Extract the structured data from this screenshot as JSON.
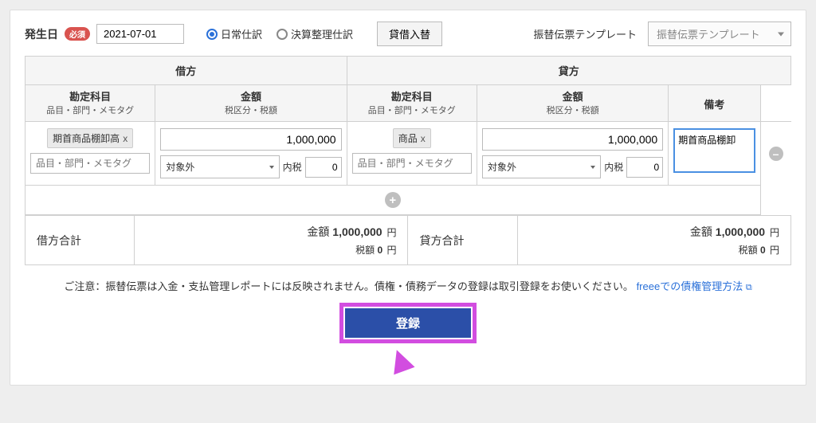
{
  "top": {
    "dateLabel": "発生日",
    "requiredBadge": "必須",
    "dateValue": "2021-07-01",
    "radio1": "日常仕訳",
    "radio2": "決算整理仕訳",
    "swapBtn": "貸借入替",
    "templateLabel": "振替伝票テンプレート",
    "templatePlaceholder": "振替伝票テンプレート"
  },
  "headers": {
    "debit": "借方",
    "credit": "貸方",
    "account": "勘定科目",
    "accountSub": "品目・部門・メモタグ",
    "amount": "金額",
    "amountSub": "税区分・税額",
    "remarks": "備考"
  },
  "row": {
    "debitAccount": "期首商品棚卸高",
    "debitAmount": "1,000,000",
    "creditAccount": "商品",
    "creditAmount": "1,000,000",
    "tagPlaceholder": "品目・部門・メモタグ",
    "taxClass": "対象外",
    "taxIncLabel": "内税",
    "taxAmt": "0",
    "memo": "期首商品棚卸"
  },
  "totals": {
    "debitLabel": "借方合計",
    "creditLabel": "貸方合計",
    "amountLabel": "金額",
    "debitAmount": "1,000,000",
    "creditAmount": "1,000,000",
    "yen": "円",
    "taxLabel": "税額",
    "taxAmount": "0"
  },
  "footer": {
    "note": "ご注意：振替伝票は入金・支払管理レポートには反映されません。債権・債務データの登録は取引登録をお使いください。",
    "link": "freeeでの債権管理方法"
  },
  "register": "登録"
}
